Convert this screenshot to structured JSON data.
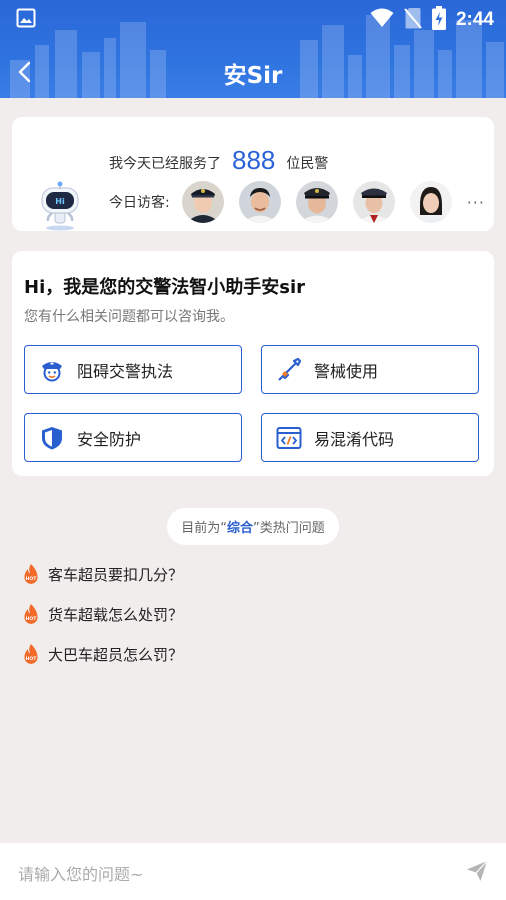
{
  "status_bar": {
    "time": "2:44"
  },
  "header": {
    "title": "安Sir"
  },
  "stats": {
    "prefix": "我今天已经服务了",
    "count": "888",
    "suffix": "位民警",
    "visitors_label": "今日访客:",
    "more": "···"
  },
  "intro": {
    "title": "Hi，我是您的交警法智小助手安sir",
    "subtitle": "您有什么相关问题都可以咨询我。"
  },
  "categories": [
    {
      "label": "阻碍交警执法",
      "icon": "police-icon"
    },
    {
      "label": "警械使用",
      "icon": "rifle-icon"
    },
    {
      "label": "安全防护",
      "icon": "shield-icon"
    },
    {
      "label": "易混淆代码",
      "icon": "code-icon"
    }
  ],
  "hot_topics": {
    "pill_prefix": "目前为“",
    "pill_category": "综合",
    "pill_suffix": "”类热门问题",
    "badge": "HOT",
    "items": [
      "客车超员要扣几分？",
      "货车超载怎么处罚？",
      "大巴车超员怎么罚？"
    ]
  },
  "input": {
    "placeholder": "请输入您的问题~"
  },
  "colors": {
    "primary": "#2a63d6",
    "hot": "#f26b2a",
    "background": "#f1eded"
  }
}
